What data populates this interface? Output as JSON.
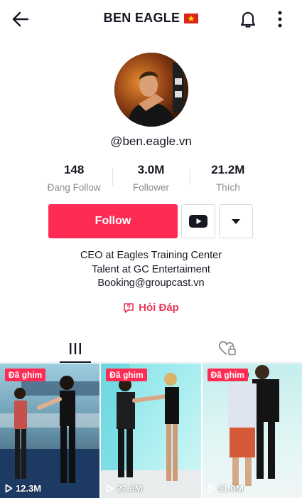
{
  "header": {
    "title": "BEN EAGLE",
    "back_icon": "arrow-left-icon",
    "flag_icon": "vietnam-flag-icon",
    "notification_icon": "bell-icon",
    "more_icon": "vertical-dots-icon"
  },
  "profile": {
    "username": "@ben.eagle.vn",
    "stats": [
      {
        "value": "148",
        "label": "Đang Follow"
      },
      {
        "value": "3.0M",
        "label": "Follower"
      },
      {
        "value": "21.2M",
        "label": "Thích"
      }
    ],
    "follow_label": "Follow",
    "youtube_icon": "youtube-icon",
    "dropdown_icon": "caret-down-icon",
    "bio": [
      "CEO at Eagles Training Center",
      "Talent at GC Entertaiment",
      "Booking@groupcast.vn"
    ],
    "qa_label": "Hỏi Đáp"
  },
  "tabs": {
    "videos_icon": "grid-bars-icon",
    "liked_icon": "heart-lock-icon"
  },
  "videos": [
    {
      "pinned_label": "Đã ghim",
      "views": "12.3M"
    },
    {
      "pinned_label": "Đã ghim",
      "views": "27.3M"
    },
    {
      "pinned_label": "Đã ghim",
      "views": "51.0M"
    }
  ],
  "colors": {
    "accent": "#fe2c55",
    "text": "#161823",
    "muted": "#8a8b91"
  }
}
